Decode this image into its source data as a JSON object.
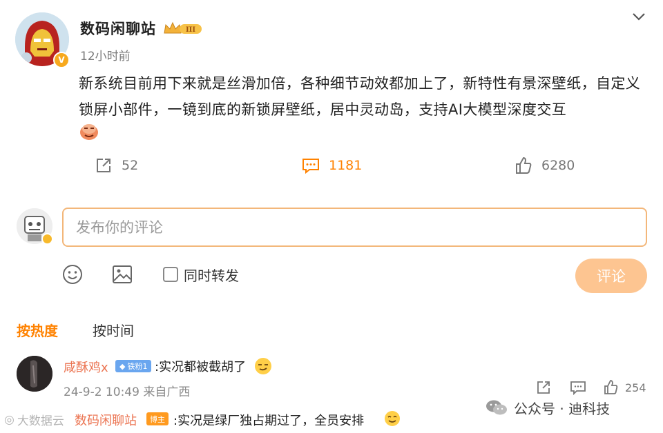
{
  "post": {
    "author": "数码闲聊站",
    "vip_level": "III",
    "verified_mark": "V",
    "time": "12小时前",
    "text": "新系统目前用下来就是丝滑加倍，各种细节动效都加上了，新特性有景深壁纸，自定义锁屏小部件，一镜到底的新锁屏壁纸，居中灵动岛，支持AI大模型深度交互",
    "emoji": "doge-face-icon",
    "reposts": "52",
    "comments": "1181",
    "likes": "6280"
  },
  "composer": {
    "placeholder": "发布你的评论",
    "repost_label": "同时转发",
    "submit_label": "评论"
  },
  "sort": {
    "hot_label": "按热度",
    "time_label": "按时间"
  },
  "comments": [
    {
      "name": "咸酥鸡x",
      "badge": "铁粉1",
      "text": ":实况都被截胡了",
      "meta": "24-9-2 10:49 来自广西",
      "likes": "254"
    },
    {
      "name": "数码闲聊站",
      "badge": "博主",
      "text": ":实况是绿厂独占期过了，全员安排"
    }
  ],
  "watermarks": {
    "left": "大数据云",
    "right": "公众号 · 迪科技"
  },
  "colors": {
    "accent": "#ff8200",
    "username": "#eb7350",
    "input_border": "#f3b77a",
    "submit_bg": "#fdc591",
    "fan_badge": "#6aa6ef",
    "blogger_badge": "#ff9a1f"
  }
}
